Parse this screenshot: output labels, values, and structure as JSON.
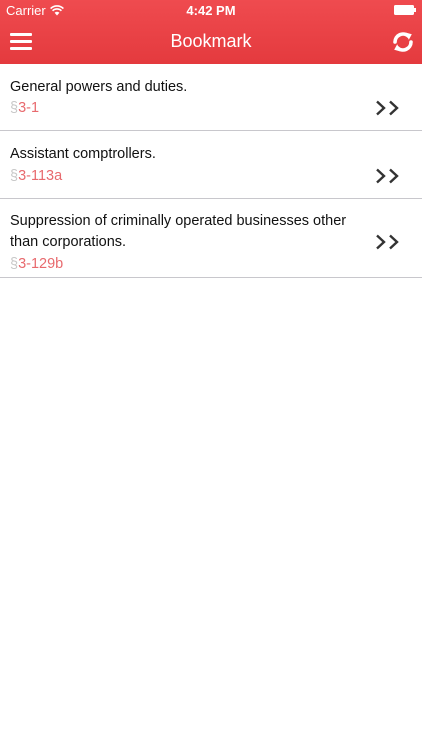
{
  "status_bar": {
    "carrier": "Carrier",
    "time": "4:42 PM"
  },
  "nav": {
    "title": "Bookmark",
    "menu_icon": "hamburger-menu-icon",
    "refresh_icon": "refresh-icon"
  },
  "bookmarks": [
    {
      "title": "General powers and duties.",
      "section_sign": "§",
      "section": "3-1"
    },
    {
      "title": "Assistant comptrollers.",
      "section_sign": "§",
      "section": "3-113a"
    },
    {
      "title": "Suppression of criminally operated businesses other than corporations.",
      "section_sign": "§",
      "section": "3-129b"
    }
  ],
  "colors": {
    "accent": "#e9464a",
    "section_text": "#e86a6e",
    "divider": "#c8c7cc"
  }
}
